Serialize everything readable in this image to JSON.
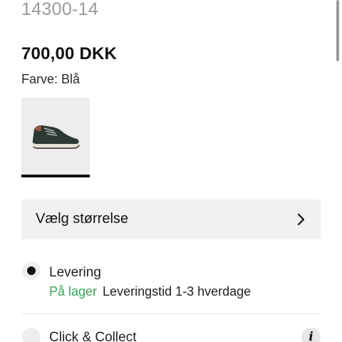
{
  "product": {
    "sku": "14300-14",
    "price": "700,00 DKK",
    "color_line": "Farve: Blå"
  },
  "swatch": {
    "icon": "sneaker-thumbnail",
    "selected": true
  },
  "size_selector": {
    "label": "Vælg størrelse",
    "icon": "chevron-right-icon"
  },
  "delivery_options": {
    "delivery": {
      "title": "Levering",
      "stock": "På lager",
      "lead_time": "Leveringstid 1-3 hverdage",
      "selected": true
    },
    "click_collect": {
      "title": "Click & Collect",
      "selected": false,
      "info_icon_glyph": "i"
    }
  },
  "colors": {
    "in_stock": "#3aa55c",
    "primary_text": "#111111",
    "muted_text": "#9a9a9a"
  }
}
